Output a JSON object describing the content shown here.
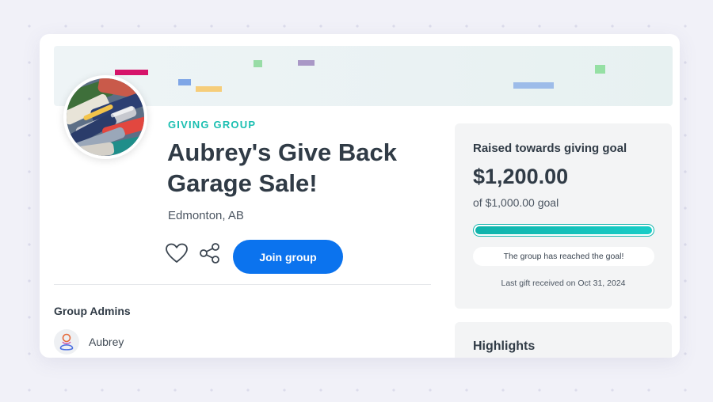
{
  "group": {
    "eyebrow": "GIVING GROUP",
    "title": "Aubrey's Give Back Garage Sale!",
    "location": "Edmonton, AB",
    "join_label": "Join group"
  },
  "icons": {
    "favorite": "heart-icon",
    "share": "share-icon"
  },
  "admins": {
    "heading": "Group Admins",
    "list": [
      {
        "name": "Aubrey"
      }
    ]
  },
  "goal": {
    "label": "Raised towards giving goal",
    "amount": "$1,200.00",
    "target": "of $1,000.00 goal",
    "progress": 1.0,
    "status": "The group has reached the goal!",
    "last_gift": "Last gift received on Oct 31, 2024"
  },
  "highlights": {
    "title": "Highlights"
  },
  "colors": {
    "accent_teal": "#1bbfb1",
    "primary_blue": "#0b73ee",
    "confetti": [
      "#d6146a",
      "#7fa6e6",
      "#f6cd7a",
      "#98dca6",
      "#a998c6",
      "#9dbce9",
      "#95e0a4"
    ]
  }
}
